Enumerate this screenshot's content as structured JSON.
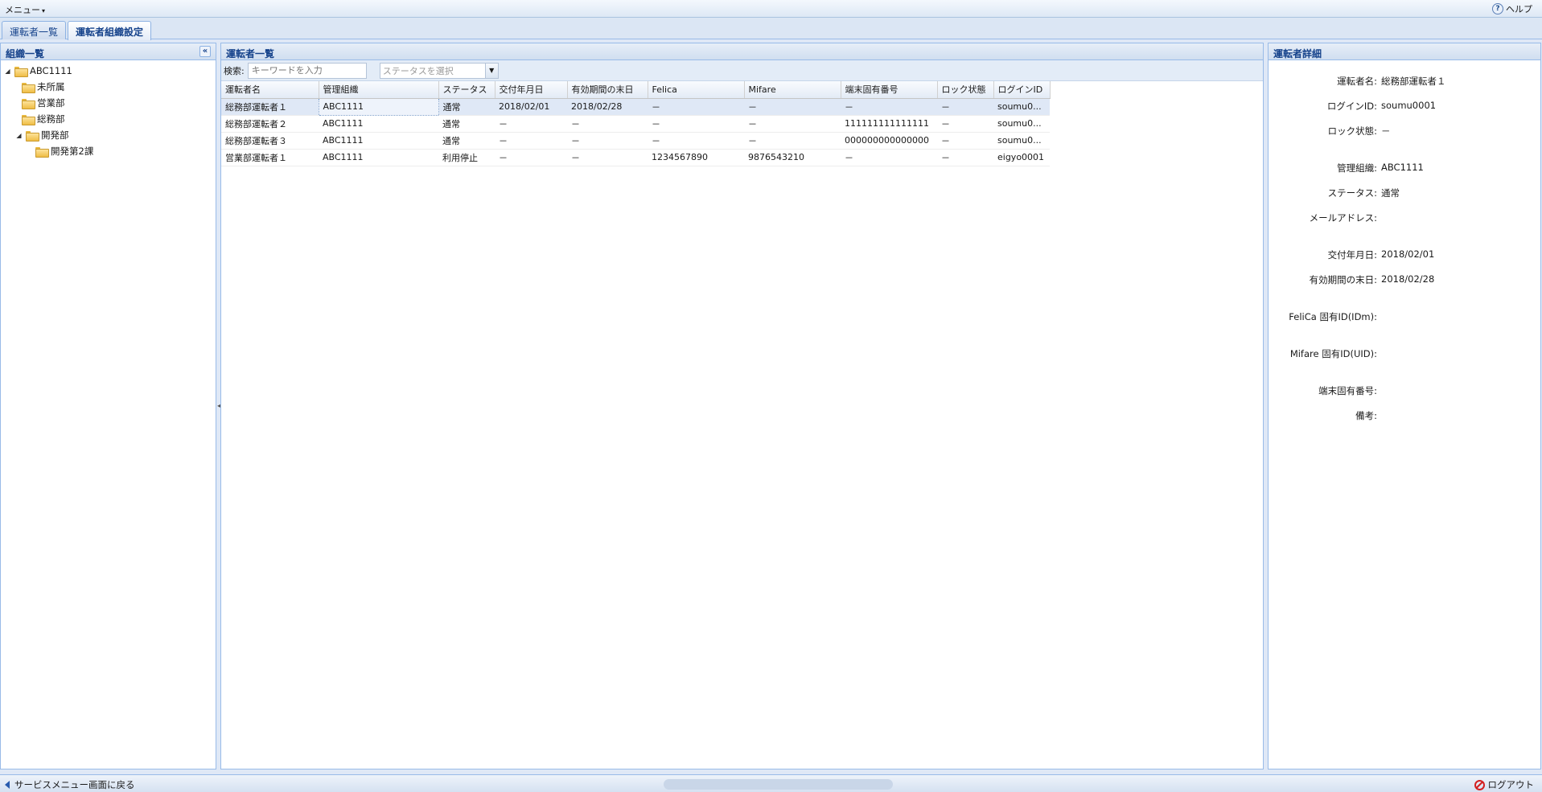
{
  "menubar": {
    "menu_label": "メニュー",
    "help_label": "ヘルプ"
  },
  "tabs": [
    {
      "label": "運転者一覧"
    },
    {
      "label": "運転者組織設定"
    }
  ],
  "org_panel": {
    "title": "組織一覧",
    "collapse_glyph": "«",
    "tree": [
      {
        "label": "ABC1111",
        "level": 0,
        "expanded": true
      },
      {
        "label": "未所属",
        "level": 1
      },
      {
        "label": "営業部",
        "level": 1
      },
      {
        "label": "総務部",
        "level": 1
      },
      {
        "label": "開発部",
        "level": 1,
        "expanded": true
      },
      {
        "label": "開発第2課",
        "level": 2
      }
    ]
  },
  "driver_list": {
    "title": "運転者一覧",
    "search_label": "検索:",
    "search_placeholder": "キーワードを入力",
    "status_placeholder": "ステータスを選択",
    "columns": [
      "運転者名",
      "管理組織",
      "ステータス",
      "交付年月日",
      "有効期間の末日",
      "Felica",
      "Mifare",
      "端末固有番号",
      "ロック状態",
      "ログインID"
    ],
    "rows": [
      [
        "総務部運転者１",
        "ABC1111",
        "通常",
        "2018/02/01",
        "2018/02/28",
        "－",
        "－",
        "－",
        "－",
        "soumu0..."
      ],
      [
        "総務部運転者２",
        "ABC1111",
        "通常",
        "－",
        "－",
        "－",
        "－",
        "111111111111111",
        "－",
        "soumu0..."
      ],
      [
        "総務部運転者３",
        "ABC1111",
        "通常",
        "－",
        "－",
        "－",
        "－",
        "000000000000000",
        "－",
        "soumu0..."
      ],
      [
        "営業部運転者１",
        "ABC1111",
        "利用停止",
        "－",
        "－",
        "1234567890",
        "9876543210",
        "－",
        "－",
        "eigyo0001"
      ]
    ],
    "selected_row": 0
  },
  "detail_panel": {
    "title": "運転者詳細",
    "driver_name": {
      "label": "運転者名:",
      "value": "総務部運転者１"
    },
    "login_id": {
      "label": "ログインID:",
      "value": "soumu0001"
    },
    "lock_state": {
      "label": "ロック状態:",
      "value": "－"
    },
    "org": {
      "label": "管理組織:",
      "value": "ABC1111"
    },
    "status": {
      "label": "ステータス:",
      "value": "通常"
    },
    "email": {
      "label": "メールアドレス:",
      "value": ""
    },
    "issue_date": {
      "label": "交付年月日:",
      "value": "2018/02/01"
    },
    "expiry_date": {
      "label": "有効期間の末日:",
      "value": "2018/02/28"
    },
    "felica": {
      "label": "FeliCa 固有ID(IDm):",
      "value": ""
    },
    "mifare": {
      "label": "Mifare 固有ID(UID):",
      "value": ""
    },
    "terminal": {
      "label": "端末固有番号:",
      "value": ""
    },
    "remarks": {
      "label": "備考:",
      "value": ""
    }
  },
  "footer": {
    "back_label": "サービスメニュー画面に戻る",
    "logout_label": "ログアウト"
  }
}
